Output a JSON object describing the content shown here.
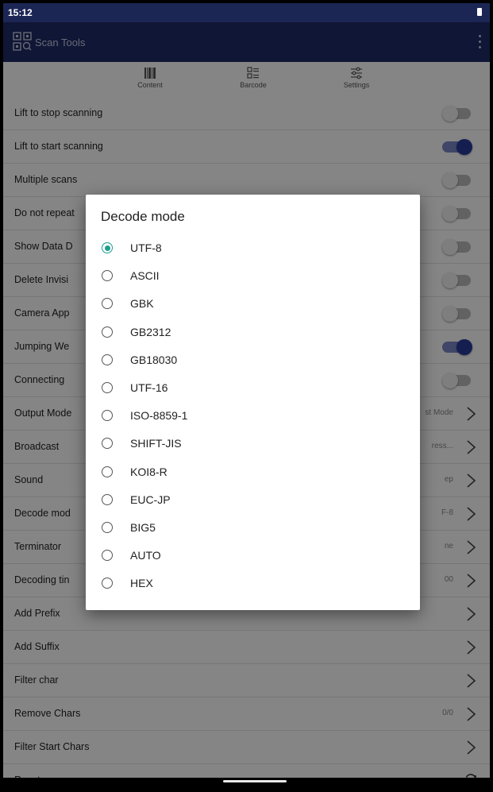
{
  "status": {
    "time": "15:12"
  },
  "appbar": {
    "title": "Scan Tools",
    "logo_icon": "qr-scan-logo-icon",
    "menu_icon": "more-vert-icon"
  },
  "tabs": [
    {
      "label": "Content",
      "icon": "qr-grid-icon"
    },
    {
      "label": "Barcode",
      "icon": "barcode-list-icon"
    },
    {
      "label": "Settings",
      "icon": "sliders-icon"
    }
  ],
  "settings": [
    {
      "label": "Lift to stop scanning",
      "type": "toggle",
      "on": false
    },
    {
      "label": "Lift to start scanning",
      "type": "toggle",
      "on": true
    },
    {
      "label": "Multiple scans",
      "type": "toggle",
      "on": false
    },
    {
      "label": "Do not repeat",
      "type": "toggle",
      "on": false
    },
    {
      "label": "Show Data D",
      "type": "toggle",
      "on": false
    },
    {
      "label": "Delete Invisi",
      "type": "toggle",
      "on": false
    },
    {
      "label": "Camera App",
      "type": "toggle",
      "on": false
    },
    {
      "label": "Jumping We",
      "type": "toggle",
      "on": true
    },
    {
      "label": "Connecting",
      "type": "toggle",
      "on": false
    },
    {
      "label": "Output Mode",
      "type": "nav",
      "value": "st Mode"
    },
    {
      "label": "Broadcast",
      "type": "nav",
      "value": "ress..."
    },
    {
      "label": "Sound",
      "type": "nav",
      "value": "ep"
    },
    {
      "label": "Decode mod",
      "type": "nav",
      "value": "F-8"
    },
    {
      "label": "Terminator",
      "type": "nav",
      "value": "ne"
    },
    {
      "label": "Decoding tin",
      "type": "nav",
      "value": "00"
    },
    {
      "label": "Add Prefix",
      "type": "nav",
      "value": ""
    },
    {
      "label": "Add Suffix",
      "type": "nav",
      "value": ""
    },
    {
      "label": "Filter char",
      "type": "nav",
      "value": ""
    },
    {
      "label": "Remove Chars",
      "type": "nav",
      "value": "0/0"
    },
    {
      "label": "Filter Start Chars",
      "type": "nav",
      "value": ""
    },
    {
      "label": "Reset scan",
      "type": "reset",
      "value": ""
    }
  ],
  "dialog": {
    "title": "Decode mode",
    "selected": "UTF-8",
    "options": [
      "UTF-8",
      "ASCII",
      "GBK",
      "GB2312",
      "GB18030",
      "UTF-16",
      "ISO-8859-1",
      "SHIFT-JIS",
      "KOI8-R",
      "EUC-JP",
      "BIG5",
      "AUTO",
      "HEX"
    ]
  },
  "colors": {
    "appbar": "#1f2b68",
    "statusbar": "#1c2655",
    "radio_accent": "#1e9e8f",
    "toggle_on": "#2a3a9c"
  }
}
